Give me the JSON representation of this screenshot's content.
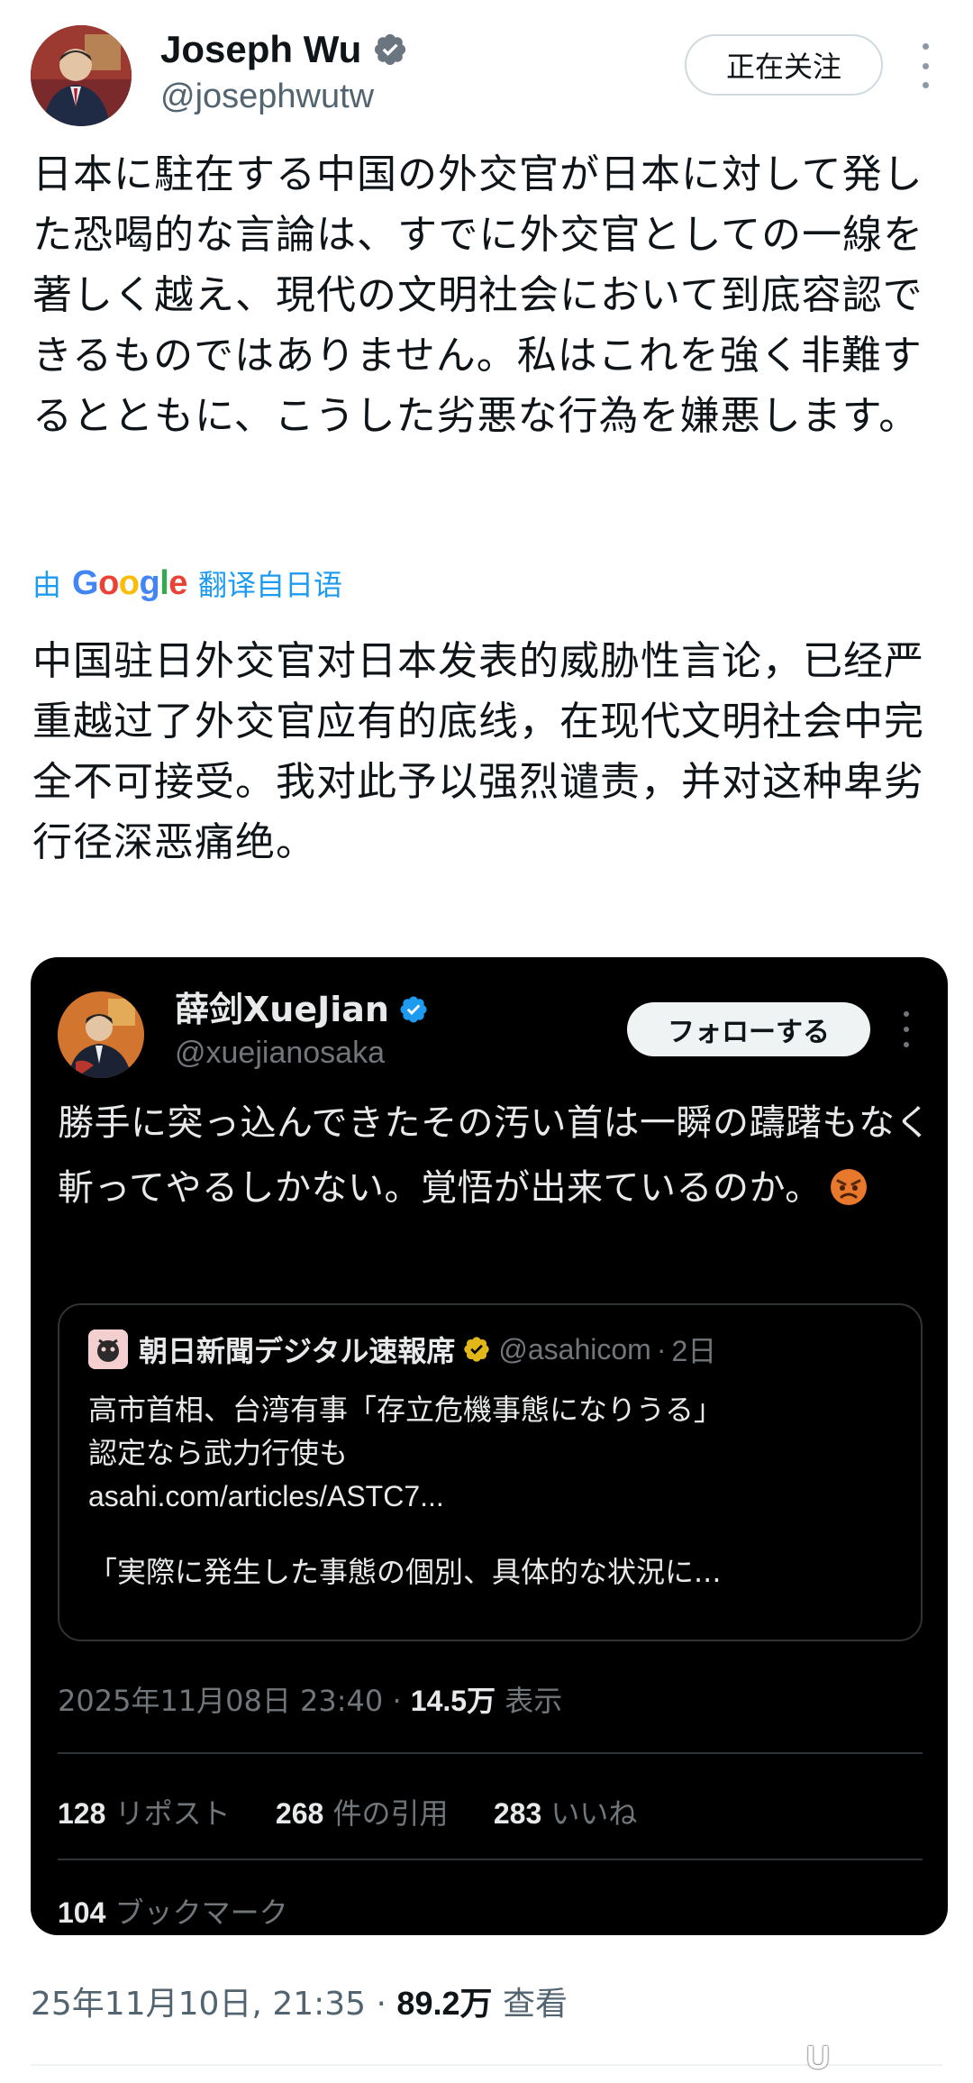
{
  "tweet": {
    "author": {
      "display_name": "Joseph Wu",
      "handle": "@josephwutw",
      "verified": true
    },
    "follow_button_label": "正在关注",
    "text": "日本に駐在する中国の外交官が日本に対して発した恐喝的な言論は、すでに外交官としての一線を著しく越え、現代の文明社会において到底容認できるものではありません。私はこれを強く非難するとともに、こうした劣悪な行為を嫌悪します。",
    "translation": {
      "by_label": "由",
      "provider": "Google",
      "link_label": "翻译自日语"
    },
    "translated_text": "中国驻日外交官对日本发表的威胁性言论，已经严重越过了外交官应有的底线，在现代文明社会中完全不可接受。我对此予以强烈谴责，并对这种卑劣行径深恶痛绝。",
    "timestamp": "25年11月10日, 21:35",
    "separator": "·",
    "views": "89.2万",
    "views_label": "查看"
  },
  "embedded_tweet": {
    "author": {
      "display_name": "薛剑XueJian",
      "handle": "@xuejianosaka",
      "verified": true
    },
    "follow_button_label": "フォローする",
    "text": "勝手に突っ込んできたその汚い首は一瞬の躊躇もなく斬ってやるしかない。覚悟が出来ているのか。",
    "emoji": "angry-face",
    "quoted": {
      "display_name": "朝日新聞デジタル速報席",
      "handle": "@asahicom",
      "separator": "·",
      "time": "2日",
      "lines": [
        "高市首相、台湾有事「存立危機事態になりうる」",
        "認定なら武力行使も"
      ],
      "link": "asahi.com/articles/ASTC7...",
      "quote_line": "「実際に発生した事態の個別、具体的な状況に..."
    },
    "datetime": "2025年11月08日 23:40",
    "separator": "·",
    "views": "14.5万",
    "views_label": "表示",
    "reposts": "128",
    "reposts_label": "リポスト",
    "quotes": "268",
    "quotes_label": "件の引用",
    "likes": "283",
    "likes_label": "いいね",
    "bookmarks": "104",
    "bookmarks_label": "ブックマーク"
  },
  "watermark": "U",
  "colors": {
    "link_blue": "#1d9bf0",
    "verified_blue": "#1d9bf0",
    "gold_badge": "#e2b719",
    "dark_card": "#000000"
  }
}
